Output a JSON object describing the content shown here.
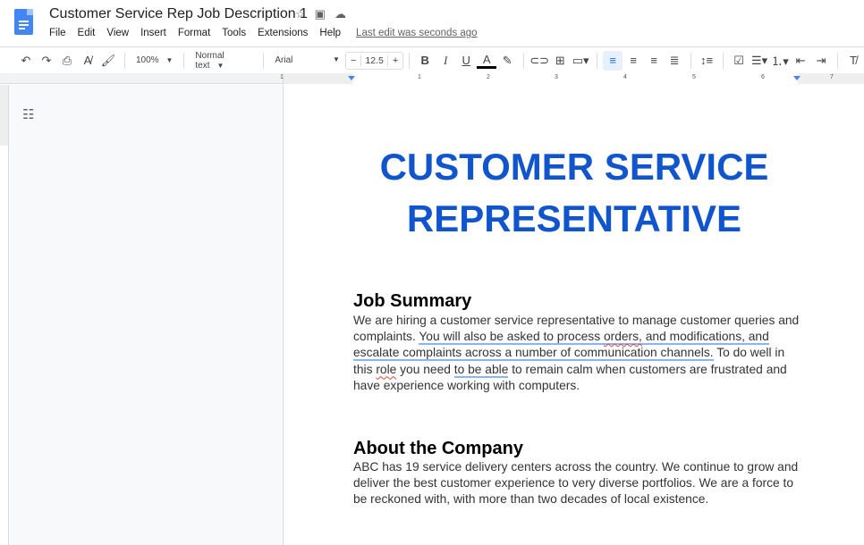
{
  "header": {
    "title": "Customer Service Rep Job Description 1",
    "icons": [
      "star-icon",
      "move-to-folder-icon",
      "cloud-saved-icon"
    ],
    "menu": [
      "File",
      "Edit",
      "View",
      "Insert",
      "Format",
      "Tools",
      "Extensions",
      "Help"
    ],
    "last_edit": "Last edit was seconds ago"
  },
  "toolbar": {
    "zoom": "100%",
    "style": "Normal text",
    "font": "Arial",
    "font_size": "12.5",
    "bold": "B",
    "italic": "I",
    "underline": "U",
    "text_color": "A"
  },
  "ruler": {
    "labels": [
      "1",
      "1",
      "2",
      "3",
      "4",
      "5",
      "6",
      "7"
    ]
  },
  "colors": {
    "title": "#1155cc",
    "accent": "#1a73e8"
  },
  "document": {
    "title_line1": "CUSTOMER SERVICE",
    "title_line2": "REPRESENTATIVE",
    "s1_heading": "Job Summary",
    "s1_a": "We are hiring a customer service representative to manage customer queries and complaints. ",
    "s1_g1a": "You will also be asked to process ",
    "s1_sp1": "orders,",
    "s1_g1b": " and modifications, and escalate complaints across a number of communication channels.",
    "s1_b": " To do well in this ",
    "s1_sp2": "role",
    "s1_c": " you need ",
    "s1_g2": "to be able",
    "s1_d": " to remain calm when customers are frustrated and have experience working with computers.",
    "s2_heading": "About the Company",
    "s2_body": "ABC has 19 service delivery centers across the country. We continue to grow and deliver the best customer experience to very diverse portfolios. We are a force to be reckoned with, with more than two decades of local existence."
  }
}
